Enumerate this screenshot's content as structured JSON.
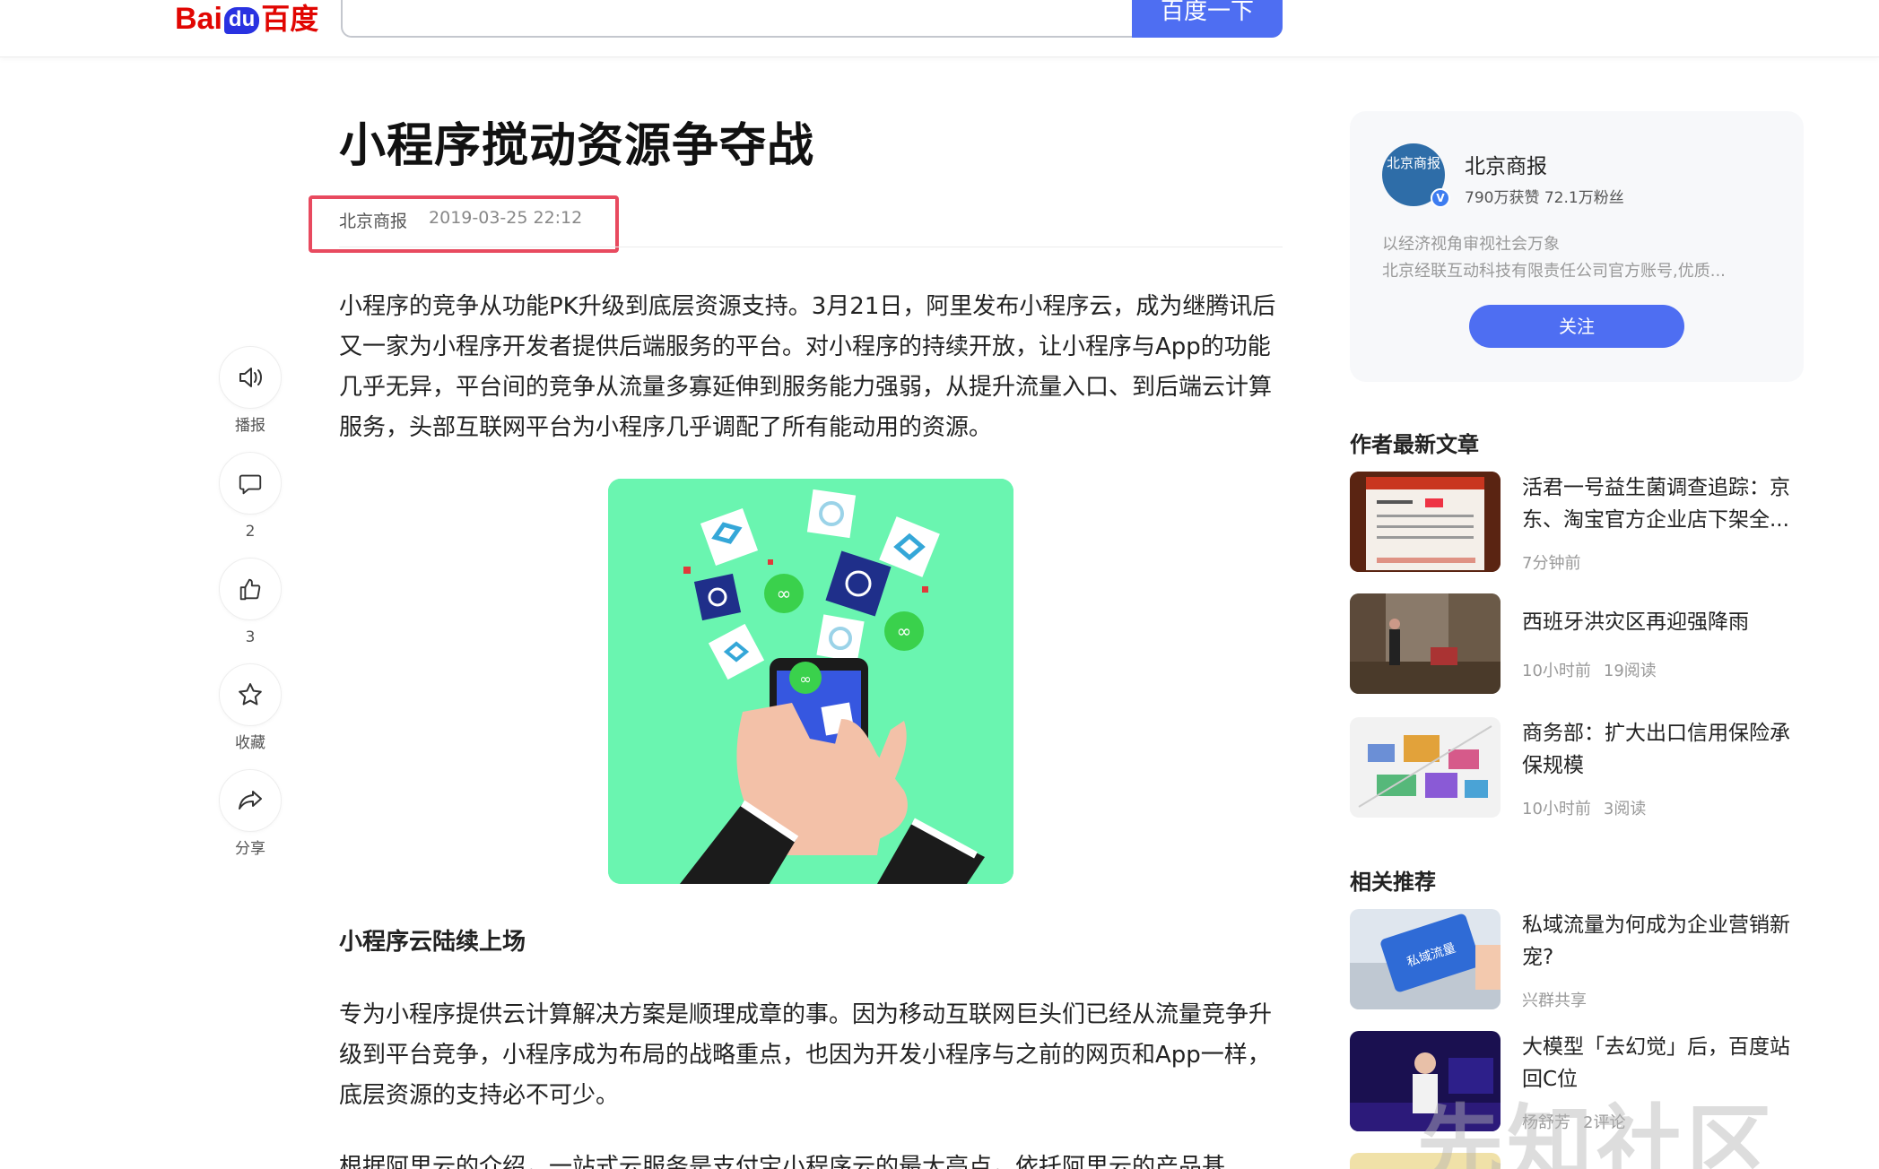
{
  "header": {
    "logo_bai": "Bai",
    "logo_du": "du",
    "logo_cn": "百度",
    "search_value": "",
    "search_button": "百度一下"
  },
  "actions": [
    {
      "icon": "speaker-icon",
      "label": "播报"
    },
    {
      "icon": "comment-icon",
      "label": "2"
    },
    {
      "icon": "thumbs-up-icon",
      "label": "3"
    },
    {
      "icon": "star-icon",
      "label": "收藏"
    },
    {
      "icon": "share-icon",
      "label": "分享"
    }
  ],
  "article": {
    "title": "小程序搅动资源争夺战",
    "source": "北京商报",
    "date": "2019-03-25 22:12",
    "para1": "小程序的竞争从功能PK升级到底层资源支持。3月21日，阿里发布小程序云，成为继腾讯后又一家为小程序开发者提供后端服务的平台。对小程序的持续开放，让小程序与App的功能几乎无异，平台间的竞争从流量多寡延伸到服务能力强弱，从提升流量入口、到后端云计算服务，头部互联网平台为小程序几乎调配了所有能动用的资源。",
    "subhead": "小程序云陆续上场",
    "para2": "专为小程序提供云计算解决方案是顺理成章的事。因为移动互联网巨头们已经从流量竞争升级到平台竞争，小程序成为布局的战略重点，也因为开发小程序与之前的网页和App一样，底层资源的支持必不可少。",
    "para3": "根据阿里云的介绍，一站式云服务是支付宝小程序云的最大亮点，依托阿里云的产品基"
  },
  "author": {
    "avatar_text": "北京商报",
    "name": "北京商报",
    "stats": "790万获赞 72.1万粉丝",
    "desc1": "以经济视角审视社会万象",
    "desc2": "北京经联互动科技有限责任公司官方账号,优质...",
    "follow": "关注"
  },
  "latest": {
    "title": "作者最新文章",
    "items": [
      {
        "title": "活君一号益生菌调查追踪：京东、淘宝官方企业店下架全...",
        "time": "7分钟前",
        "reads": ""
      },
      {
        "title": "西班牙洪灾区再迎强降雨",
        "time": "10小时前",
        "reads": "19阅读"
      },
      {
        "title": "商务部：扩大出口信用保险承保规模",
        "time": "10小时前",
        "reads": "3阅读"
      }
    ]
  },
  "related": {
    "title": "相关推荐",
    "items": [
      {
        "title": "私域流量为何成为企业营销新宠?",
        "source": "兴群共享",
        "extra": ""
      },
      {
        "title": "大模型「去幻觉」后，百度站回C位",
        "source": "杨舒芳",
        "extra": "2评论"
      }
    ]
  },
  "watermark": "先知社区",
  "colors": {
    "accent": "#4e6ef2",
    "highlight": "#e84a5f",
    "figure_bg": "#6af5b0"
  }
}
